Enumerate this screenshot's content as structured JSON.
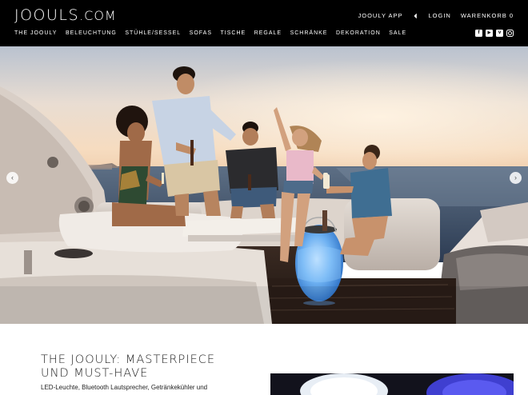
{
  "header": {
    "logo_main": "JOOULS",
    "logo_tld": ".COM",
    "utility": {
      "app_label": "JOOULY APP",
      "speaker_icon": "speaker-icon",
      "login_label": "LOGIN",
      "cart_label": "WARENKORB 0"
    },
    "nav": [
      "THE JOOULY",
      "BELEUCHTUNG",
      "STÜHLE/SESSEL",
      "SOFAS",
      "TISCHE",
      "REGALE",
      "SCHRÄNKE",
      "DEKORATION",
      "SALE"
    ],
    "social": {
      "facebook_glyph": "f",
      "youtube_glyph": "▶",
      "vimeo_glyph": "v",
      "icons": [
        "facebook-icon",
        "youtube-icon",
        "vimeo-icon",
        "instagram-icon"
      ]
    }
  },
  "hero": {
    "prev_glyph": "‹",
    "next_glyph": "›",
    "prev_icon": "arrow-left-icon",
    "next_icon": "arrow-right-icon"
  },
  "content": {
    "headline_line1": "THE JOOULY: MASTERPIECE",
    "headline_line2": "UND MUST-HAVE",
    "description": "LED-Leuchte, Bluetooth Lautsprecher, Getränkekühler und"
  },
  "colors": {
    "header_bg": "#000000",
    "header_text": "#ffffff",
    "body_text": "#222222"
  }
}
